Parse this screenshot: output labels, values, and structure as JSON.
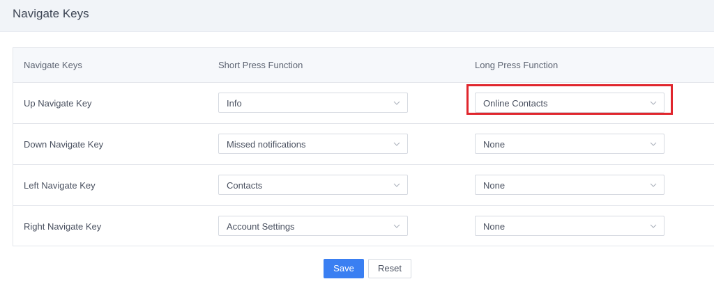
{
  "header": {
    "title": "Navigate Keys"
  },
  "table": {
    "columns": [
      "Navigate Keys",
      "Short Press Function",
      "Long Press Function"
    ],
    "rows": [
      {
        "label": "Up Navigate Key",
        "short": "Info",
        "long": "Online Contacts"
      },
      {
        "label": "Down Navigate Key",
        "short": "Missed notifications",
        "long": "None"
      },
      {
        "label": "Left Navigate Key",
        "short": "Contacts",
        "long": "None"
      },
      {
        "label": "Right Navigate Key",
        "short": "Account Settings",
        "long": "None"
      }
    ]
  },
  "actions": {
    "save": "Save",
    "reset": "Reset"
  },
  "colors": {
    "accent": "#3a7ff2",
    "highlight": "#e0262d"
  },
  "icons": {
    "dropdown": "chevron-down-icon"
  }
}
